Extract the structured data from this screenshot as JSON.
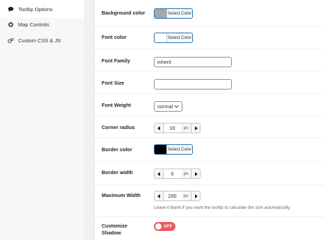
{
  "sidebar": {
    "items": [
      {
        "label": "Tooltip Options",
        "icon": "speech-bubble-icon",
        "active": true
      },
      {
        "label": "Map Controls",
        "icon": "map-marker-icon",
        "active": false
      },
      {
        "label": "Custom CSS & JS",
        "icon": "gears-icon",
        "active": false
      }
    ]
  },
  "settings": {
    "background_color": {
      "label": "Background color",
      "button": "Select Color",
      "swatch": "#a7a7a7"
    },
    "font_color": {
      "label": "Font color",
      "button": "Select Color",
      "swatch": "#ffffff"
    },
    "font_family": {
      "label": "Font Family",
      "value": "inherit"
    },
    "font_size": {
      "label": "Font Size",
      "value": ""
    },
    "font_weight": {
      "label": "Font Weight",
      "value": "normal"
    },
    "corner_radius": {
      "label": "Corner radius",
      "value": "10",
      "unit": "px"
    },
    "border_color": {
      "label": "Border color",
      "button": "Select Color",
      "swatch": "#000000"
    },
    "border_width": {
      "label": "Border width",
      "value": "0",
      "unit": "px"
    },
    "maximum_width": {
      "label": "Maximum Width",
      "value": "200",
      "unit": "px",
      "hint": "Leave it blank if you want the tooltip to calculate the size automatically."
    },
    "customize_shadow": {
      "label_line1": "Customize",
      "label_line2": "Shadow",
      "toggle": "OFF"
    }
  },
  "colors": {
    "accent": "#2271b1",
    "toggle_off": "#e9595f"
  }
}
